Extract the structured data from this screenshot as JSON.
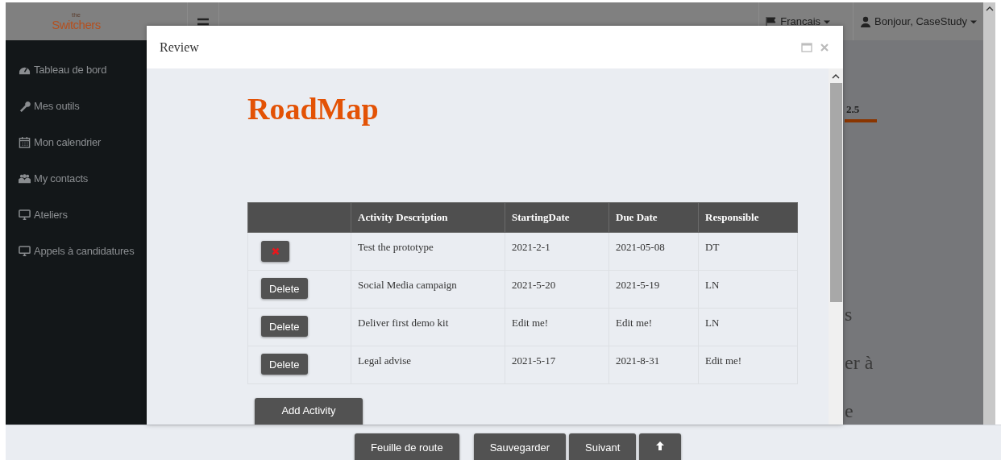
{
  "topbar": {
    "logo_small": "the",
    "logo": "Switchers",
    "language": "Francais",
    "user": "Bonjour, CaseStudy"
  },
  "sidebar": {
    "items": [
      {
        "label": "Tableau de bord",
        "kind": "dashboard"
      },
      {
        "label": "Mes outils",
        "kind": "tools"
      },
      {
        "label": "Mon calendrier",
        "kind": "calendar"
      },
      {
        "label": "My contacts",
        "kind": "contacts"
      },
      {
        "label": "Ateliers",
        "kind": "workshops"
      },
      {
        "label": "Appels à candidatures",
        "kind": "calls"
      }
    ]
  },
  "background_page": {
    "tab_label": "2.5",
    "text_fragments": [
      "s",
      "er à",
      "e"
    ]
  },
  "modal": {
    "title": "Review",
    "heading": "RoadMap",
    "table": {
      "columns": [
        "Activity Description",
        "StartingDate",
        "Due Date",
        "Responsible"
      ],
      "rows": [
        {
          "action": {
            "kind": "icon"
          },
          "cells": [
            "Test the prototype",
            "2021-2-1",
            "2021-05-08",
            "DT"
          ]
        },
        {
          "action": {
            "kind": "text",
            "label": "Delete"
          },
          "cells": [
            "Social Media campaign",
            "2021-5-20",
            "2021-5-19",
            "LN"
          ]
        },
        {
          "action": {
            "kind": "text",
            "label": "Delete"
          },
          "cells": [
            "Deliver first demo kit",
            "Edit me!",
            "Edit me!",
            "LN"
          ]
        },
        {
          "action": {
            "kind": "text",
            "label": "Delete"
          },
          "cells": [
            "Legal advise",
            "2021-5-17",
            "2021-8-31",
            "Edit me!"
          ]
        }
      ]
    },
    "add_button": "Add Activity"
  },
  "footer": {
    "buttons": [
      {
        "kind": "text",
        "label": "Feuille de route"
      },
      {
        "kind": "text",
        "label": "Sauvegarder"
      },
      {
        "kind": "text",
        "label": "Suivant"
      },
      {
        "kind": "icon"
      }
    ]
  }
}
